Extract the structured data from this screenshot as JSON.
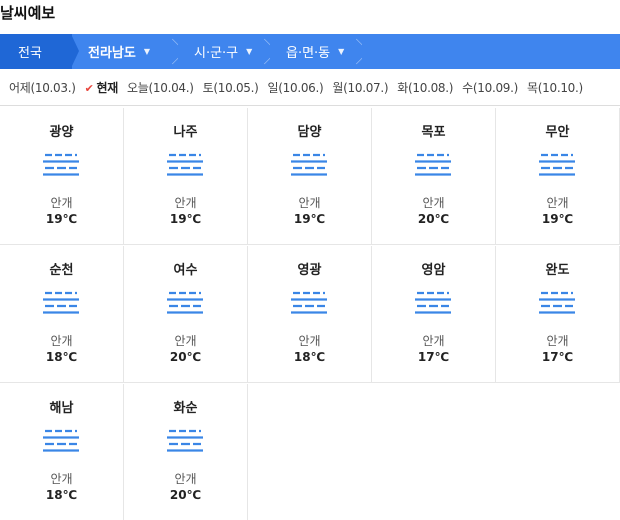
{
  "page_title": "날씨예보",
  "breadcrumb": {
    "items": [
      {
        "label": "전국",
        "dropdown": false
      },
      {
        "label": "전라남도",
        "dropdown": true
      },
      {
        "label": "시·군·구",
        "dropdown": true
      },
      {
        "label": "읍·면·동",
        "dropdown": true
      }
    ],
    "dropdown_icon": "triangle-down-icon"
  },
  "dates": [
    {
      "label": "어제(10.03.)",
      "current": false
    },
    {
      "label": "현재",
      "current": true
    },
    {
      "label": "오늘(10.04.)",
      "current": false
    },
    {
      "label": "토(10.05.)",
      "current": false
    },
    {
      "label": "일(10.06.)",
      "current": false
    },
    {
      "label": "월(10.07.)",
      "current": false
    },
    {
      "label": "화(10.08.)",
      "current": false
    },
    {
      "label": "수(10.09.)",
      "current": false
    },
    {
      "label": "목(10.10.)",
      "current": false
    }
  ],
  "current_marker_icon": "checkmark-icon",
  "cities": [
    {
      "name": "광양",
      "condition": "안개",
      "temp": "19℃",
      "icon": "fog-icon"
    },
    {
      "name": "나주",
      "condition": "안개",
      "temp": "19℃",
      "icon": "fog-icon"
    },
    {
      "name": "담양",
      "condition": "안개",
      "temp": "19℃",
      "icon": "fog-icon"
    },
    {
      "name": "목포",
      "condition": "안개",
      "temp": "20℃",
      "icon": "fog-icon"
    },
    {
      "name": "무안",
      "condition": "안개",
      "temp": "19℃",
      "icon": "fog-icon"
    },
    {
      "name": "순천",
      "condition": "안개",
      "temp": "18℃",
      "icon": "fog-icon"
    },
    {
      "name": "여수",
      "condition": "안개",
      "temp": "20℃",
      "icon": "fog-icon"
    },
    {
      "name": "영광",
      "condition": "안개",
      "temp": "18℃",
      "icon": "fog-icon"
    },
    {
      "name": "영암",
      "condition": "안개",
      "temp": "17℃",
      "icon": "fog-icon"
    },
    {
      "name": "완도",
      "condition": "안개",
      "temp": "17℃",
      "icon": "fog-icon"
    },
    {
      "name": "해남",
      "condition": "안개",
      "temp": "18℃",
      "icon": "fog-icon"
    },
    {
      "name": "화순",
      "condition": "안개",
      "temp": "20℃",
      "icon": "fog-icon"
    }
  ],
  "colors": {
    "breadcrumb_bg": "#3f85ee",
    "breadcrumb_active_bg": "#1f67d6",
    "fog_icon": "#3a86e6",
    "current_check": "#e8453c"
  }
}
